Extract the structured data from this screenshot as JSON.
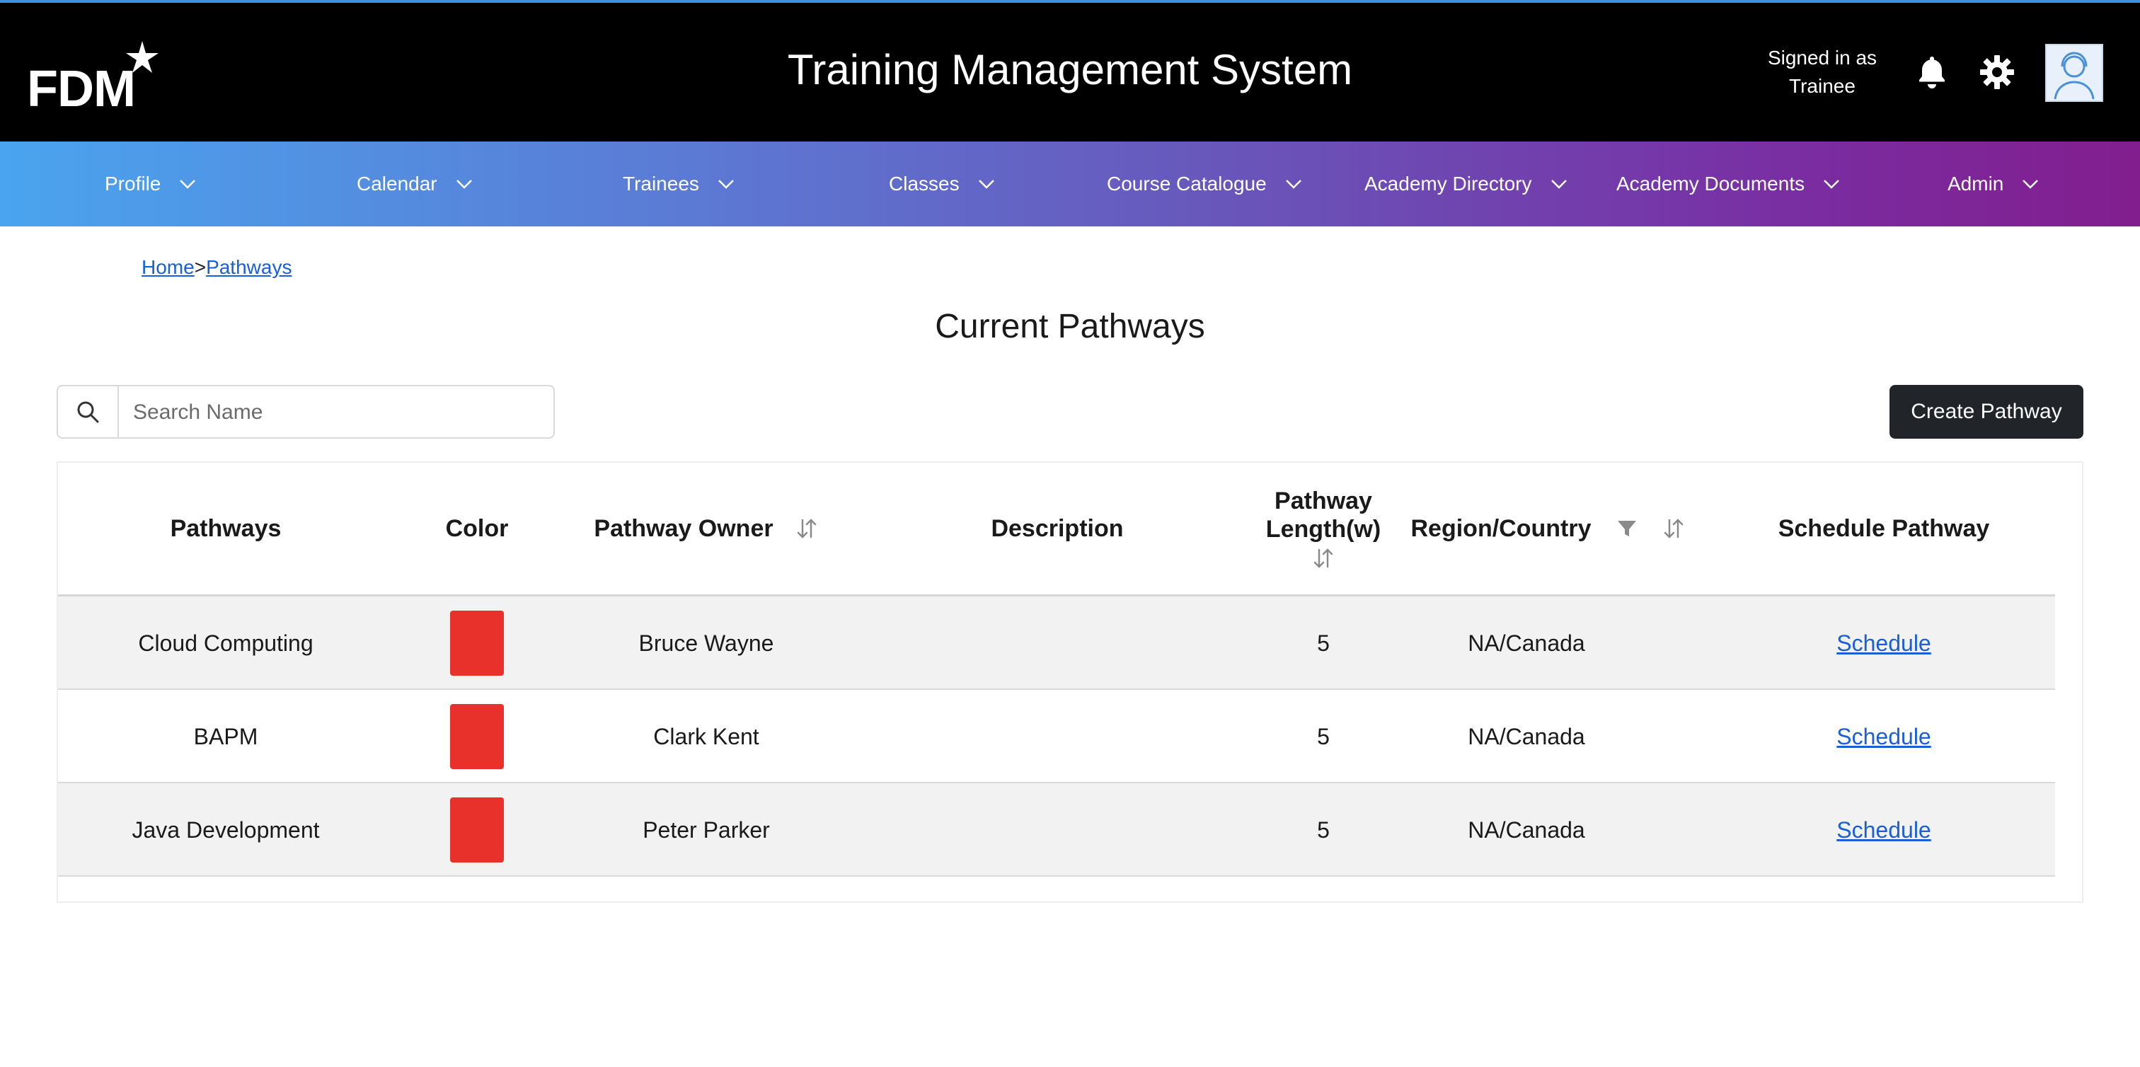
{
  "header": {
    "logo_text": "FDM",
    "app_title": "Training Management System",
    "signed_in_line1": "Signed in as",
    "signed_in_line2": "Trainee",
    "icons": [
      "bell-icon",
      "gear-icon",
      "avatar"
    ]
  },
  "nav": {
    "items": [
      {
        "label": "Profile"
      },
      {
        "label": "Calendar"
      },
      {
        "label": "Trainees"
      },
      {
        "label": "Classes"
      },
      {
        "label": "Course Catalogue"
      },
      {
        "label": "Academy Directory"
      },
      {
        "label": "Academy Documents"
      },
      {
        "label": "Admin"
      }
    ]
  },
  "breadcrumb": {
    "home": "Home",
    "separator": ">",
    "current": "Pathways"
  },
  "page": {
    "title": "Current Pathways"
  },
  "search": {
    "placeholder": "Search Name",
    "value": ""
  },
  "actions": {
    "create_label": "Create Pathway"
  },
  "table": {
    "headers": {
      "pathways": "Pathways",
      "color": "Color",
      "owner": "Pathway Owner",
      "description": "Description",
      "length_line1": "Pathway",
      "length_line2": "Length(w)",
      "region": "Region/Country",
      "schedule": "Schedule Pathway"
    },
    "rows": [
      {
        "name": "Cloud Computing",
        "color": "#e8312a",
        "owner": "Bruce Wayne",
        "description": "",
        "length": "5",
        "region": "NA/Canada",
        "action": "Schedule"
      },
      {
        "name": "BAPM",
        "color": "#e8312a",
        "owner": "Clark Kent",
        "description": "",
        "length": "5",
        "region": "NA/Canada",
        "action": "Schedule"
      },
      {
        "name": "Java Development",
        "color": "#e8312a",
        "owner": "Peter Parker",
        "description": "",
        "length": "5",
        "region": "NA/Canada",
        "action": "Schedule"
      }
    ]
  },
  "colors": {
    "header_bg": "#000000",
    "nav_gradient_start": "#4aa4ee",
    "nav_gradient_end": "#821e8e",
    "link": "#1a5fd8",
    "primary_button": "#212529"
  }
}
